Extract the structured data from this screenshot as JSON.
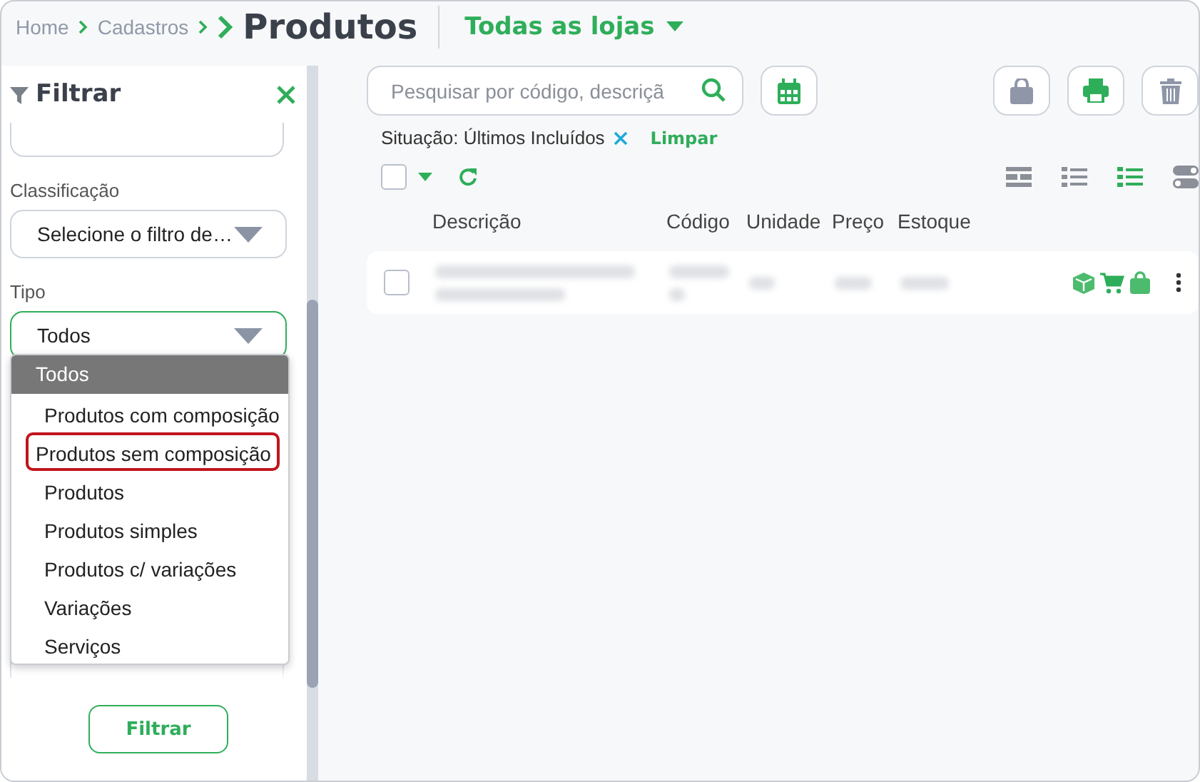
{
  "breadcrumb": [
    {
      "label": "Home"
    },
    {
      "label": "Cadastros"
    }
  ],
  "page_title": "Produtos",
  "store_selector": {
    "label": "Todas as lojas"
  },
  "filter_panel": {
    "title": "Filtrar",
    "fields": [
      {
        "label": "Classificação",
        "value": "Selecione o filtro de…",
        "focused": false
      },
      {
        "label": "Tipo",
        "value": "Todos",
        "focused": true
      }
    ],
    "dropdown": [
      {
        "label": "Todos",
        "selected": true,
        "outlined": false
      },
      {
        "label": "Produtos com composição",
        "selected": false,
        "outlined": false
      },
      {
        "label": "Produtos sem composição",
        "selected": false,
        "outlined": true
      },
      {
        "label": "Produtos",
        "selected": false,
        "outlined": false
      },
      {
        "label": "Produtos simples",
        "selected": false,
        "outlined": false
      },
      {
        "label": "Produtos c/ variações",
        "selected": false,
        "outlined": false
      },
      {
        "label": "Variações",
        "selected": false,
        "outlined": false
      },
      {
        "label": "Serviços",
        "selected": false,
        "outlined": false
      }
    ],
    "apply_button": "Filtrar"
  },
  "search": {
    "placeholder": "Pesquisar por código, descriçã"
  },
  "active_filter": {
    "label": "Situação: Últimos Incluídos",
    "clear": "Limpar"
  },
  "view_modes": [
    {
      "selected": false
    },
    {
      "selected": false
    },
    {
      "selected": true
    }
  ],
  "select_all": {
    "checked": false
  },
  "table": {
    "columns": [
      "Descrição",
      "Código",
      "Unidade",
      "Preço",
      "Estoque"
    ],
    "rows": [
      {
        "checked": false
      }
    ]
  }
}
